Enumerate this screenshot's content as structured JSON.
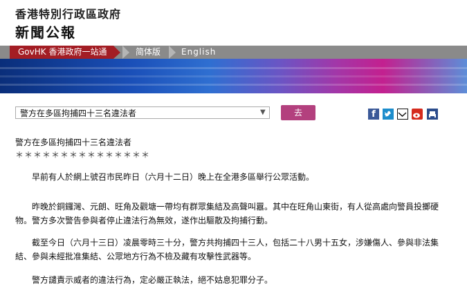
{
  "header": {
    "org_name": "香港特別行政區政府",
    "brand": "新聞公報"
  },
  "nav": {
    "govhk": "GovHK 香港政府一站通",
    "simplified": "简体版",
    "english": "English"
  },
  "topic": {
    "selected": "警方在多區拘捕四十三名違法者",
    "go_label": "去"
  },
  "share_icons": [
    "facebook-icon",
    "twitter-icon",
    "email-icon",
    "weibo-icon",
    "print-icon"
  ],
  "article": {
    "title": "警方在多區拘捕四十三名違法者",
    "stars": "＊＊＊＊＊＊＊＊＊＊＊＊＊＊＊",
    "p1": "　　早前有人於網上號召市民昨日（六月十二日）晚上在全港多區舉行公眾活動。",
    "p2": "　　昨晚於銅鑼灣、元朗、旺角及觀塘一帶均有群眾集結及高聲叫囂。其中在旺角山東街，有人從高處向警員投擲硬物。警方多次警告參與者停止違法行為無效，遂作出驅散及拘捕行動。",
    "p3": "　　截至今日（六月十三日）凌晨零時三十分，警方共拘捕四十三人，包括二十八男十五女，涉嫌傷人、參與非法集結、參與未經批准集結、公眾地方行為不檢及藏有攻擊性武器等。",
    "p4": "　　警方譴責示威者的違法行為，定必嚴正執法，絕不姑息犯罪分子。"
  }
}
